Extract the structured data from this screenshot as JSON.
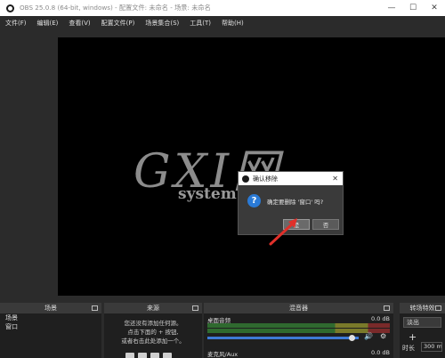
{
  "window": {
    "title": "OBS 25.0.8 (64-bit, windows) - 配置文件: 未命名 - 场景: 未命名",
    "minimize": "—",
    "maximize": "☐",
    "close": "✕"
  },
  "menu": [
    "文件(F)",
    "编辑(E)",
    "查看(V)",
    "配置文件(P)",
    "场景集合(S)",
    "工具(T)",
    "帮助(H)"
  ],
  "watermark": {
    "big": "GXI网",
    "small": "system.com"
  },
  "dialog": {
    "title": "确认移除",
    "close": "✕",
    "message": "确定要删除 '窗口' 吗?",
    "yes": "是",
    "no": "否"
  },
  "docks": {
    "scenes": {
      "title": "场景",
      "items": [
        "场景",
        "窗口"
      ]
    },
    "sources": {
      "title": "来源",
      "hint_lines": [
        "您还没有添加任何源。",
        "点击下面的 + 按钮,",
        "或者右击此处添加一个。"
      ]
    },
    "mixer": {
      "title": "混音器",
      "channels": [
        {
          "name": "桌面音频",
          "db": "0.0 dB"
        },
        {
          "name": "麦克风/Aux",
          "db": "0.0 dB"
        }
      ],
      "volume_level": 0.95
    },
    "transitions": {
      "title": "转场特效",
      "selected": "淡出",
      "add": "+",
      "duration_label": "时长",
      "duration_value": "300 ms"
    }
  },
  "colors": {
    "background": "#2b2b2b",
    "preview": "#000000",
    "accent": "#3d7ad6",
    "arrow": "#e0302a"
  }
}
